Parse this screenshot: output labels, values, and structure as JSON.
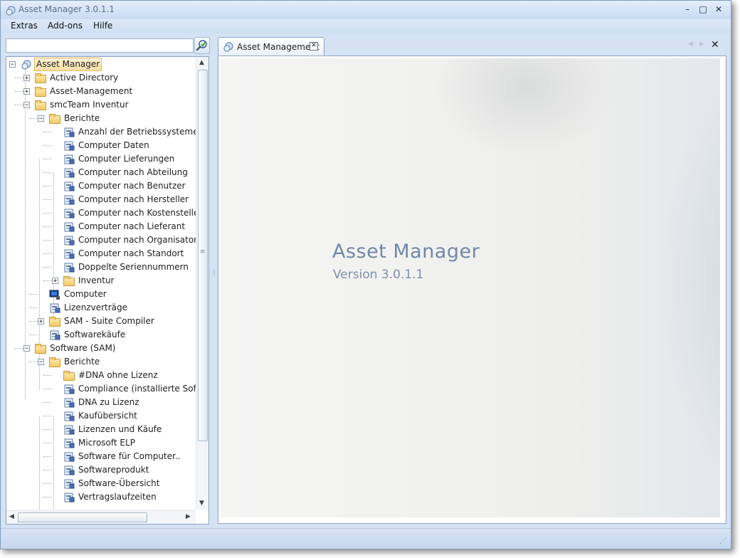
{
  "window": {
    "title": "Asset Manager 3.0.1.1",
    "minimize": "–",
    "maximize": "□",
    "close": "✕"
  },
  "menu": {
    "items": [
      "Extras",
      "Add-ons",
      "Hilfe"
    ]
  },
  "search": {
    "value": "",
    "placeholder": ""
  },
  "tree": {
    "nodes": [
      {
        "label": "Asset Manager",
        "level": 0,
        "icon": "app-icon",
        "expander": "minus",
        "selected": true
      },
      {
        "label": "Active Directory",
        "level": 1,
        "icon": "folder-icon",
        "expander": "plus"
      },
      {
        "label": "Asset-Management",
        "level": 1,
        "icon": "folder-icon",
        "expander": "plus"
      },
      {
        "label": "smcTeam Inventur",
        "level": 1,
        "icon": "folder-open-icon",
        "expander": "minus"
      },
      {
        "label": "Berichte",
        "level": 2,
        "icon": "folder-open-icon",
        "expander": "minus"
      },
      {
        "label": "Anzahl der Betriebssysteme",
        "level": 3,
        "icon": "report-icon"
      },
      {
        "label": "Computer Daten",
        "level": 3,
        "icon": "report-icon"
      },
      {
        "label": "Computer Lieferungen",
        "level": 3,
        "icon": "report-icon"
      },
      {
        "label": "Computer nach Abteilung",
        "level": 3,
        "icon": "report-icon"
      },
      {
        "label": "Computer nach Benutzer",
        "level": 3,
        "icon": "report-icon"
      },
      {
        "label": "Computer nach Hersteller",
        "level": 3,
        "icon": "report-icon"
      },
      {
        "label": "Computer nach Kostenstellen",
        "level": 3,
        "icon": "report-icon"
      },
      {
        "label": "Computer nach Lieferant",
        "level": 3,
        "icon": "report-icon"
      },
      {
        "label": "Computer  nach  Organisatori...",
        "level": 3,
        "icon": "report-icon"
      },
      {
        "label": "Computer nach Standort",
        "level": 3,
        "icon": "report-icon"
      },
      {
        "label": "Doppelte Seriennummern",
        "level": 3,
        "icon": "report-icon"
      },
      {
        "label": "Inventur",
        "level": 3,
        "icon": "folder-icon",
        "expander": "plus"
      },
      {
        "label": "Computer",
        "level": 2,
        "icon": "computer-icon"
      },
      {
        "label": "Lizenzverträge",
        "level": 2,
        "icon": "report-icon"
      },
      {
        "label": "SAM - Suite Compiler",
        "level": 2,
        "icon": "folder-icon",
        "expander": "plus"
      },
      {
        "label": "Softwarekäufe",
        "level": 2,
        "icon": "report-icon"
      },
      {
        "label": "Software (SAM)",
        "level": 1,
        "icon": "folder-open-icon",
        "expander": "minus"
      },
      {
        "label": "Berichte",
        "level": 2,
        "icon": "folder-open-icon",
        "expander": "minus"
      },
      {
        "label": "#DNA ohne Lizenz",
        "level": 3,
        "icon": "folder-report-icon"
      },
      {
        "label": "Compliance  (installierte  Soft...",
        "level": 3,
        "icon": "report-icon"
      },
      {
        "label": "DNA zu Lizenz",
        "level": 3,
        "icon": "report-icon"
      },
      {
        "label": "Kaufübersicht",
        "level": 3,
        "icon": "report-icon"
      },
      {
        "label": "Lizenzen und Käufe",
        "level": 3,
        "icon": "report-icon"
      },
      {
        "label": "Microsoft ELP",
        "level": 3,
        "icon": "report-icon"
      },
      {
        "label": "Software für Computer..",
        "level": 3,
        "icon": "report-icon"
      },
      {
        "label": "Softwareprodukt",
        "level": 3,
        "icon": "report-icon"
      },
      {
        "label": "Software-Übersicht",
        "level": 3,
        "icon": "report-icon"
      },
      {
        "label": "Vertragslaufzeiten",
        "level": 3,
        "icon": "report-icon"
      }
    ]
  },
  "tabs": [
    {
      "label": "Asset Management",
      "close": "✕"
    }
  ],
  "tab_strip": {
    "close_all": "✕"
  },
  "content": {
    "title": "Asset Manager",
    "version": "Version 3.0.1.1"
  },
  "colors": {
    "accent": "#7288a6",
    "window_bg": "#d4e2f4",
    "selection": "#f9dfa4"
  }
}
